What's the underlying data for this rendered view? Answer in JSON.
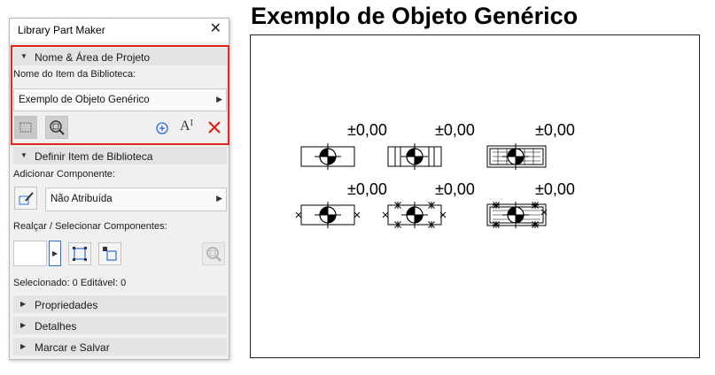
{
  "window": {
    "title": "Library Part Maker"
  },
  "sections": {
    "name_area": "Nome & Área de Projeto",
    "define_item": "Definir Item de Biblioteca",
    "properties": "Propriedades",
    "details": "Detalhes",
    "mark_save": "Marcar e Salvar"
  },
  "name_area": {
    "name_label": "Nome do Item da Biblioteca:",
    "name_value": "Exemplo de Objeto Genérico"
  },
  "define": {
    "add_component_label": "Adicionar Componente:",
    "component_value": "Não Atribuída",
    "highlight_label": "Realçar / Selecionar Componentes:",
    "status": "Selecionado: 0 Editável: 0"
  },
  "preview": {
    "title": "Exemplo de Objeto Genérico",
    "dimensions": [
      "±0,00",
      "±0,00",
      "±0,00",
      "±0,00",
      "±0,00",
      "±0,00"
    ]
  },
  "colors": {
    "highlight_border": "#e0261d",
    "add_icon": "#2b6fd6",
    "delete_icon": "#e0261d"
  }
}
